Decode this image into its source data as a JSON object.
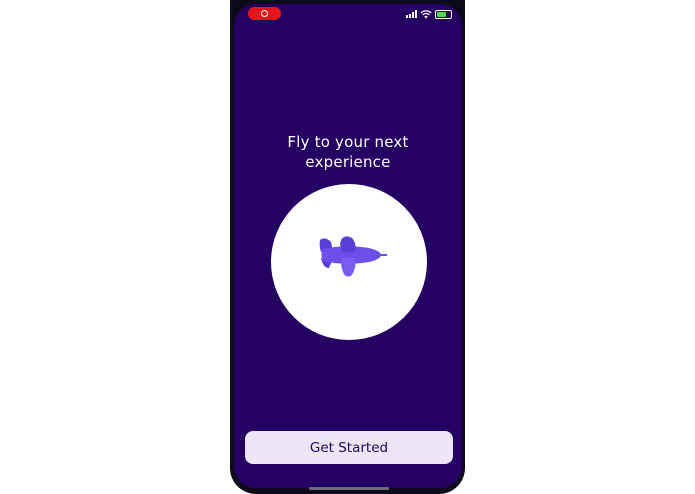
{
  "onboarding": {
    "title_line1": "Fly to your next",
    "title_line2": "experience",
    "cta_label": "Get Started"
  },
  "icons": {
    "illustration": "airplane-icon",
    "record": "screen-record-icon",
    "signal": "cellular-signal-icon",
    "wifi": "wifi-icon",
    "battery": "battery-icon"
  },
  "colors": {
    "background": "#250063",
    "plane": "#6c4ee8",
    "button_bg": "#ece6f6",
    "record": "#e8141c"
  }
}
